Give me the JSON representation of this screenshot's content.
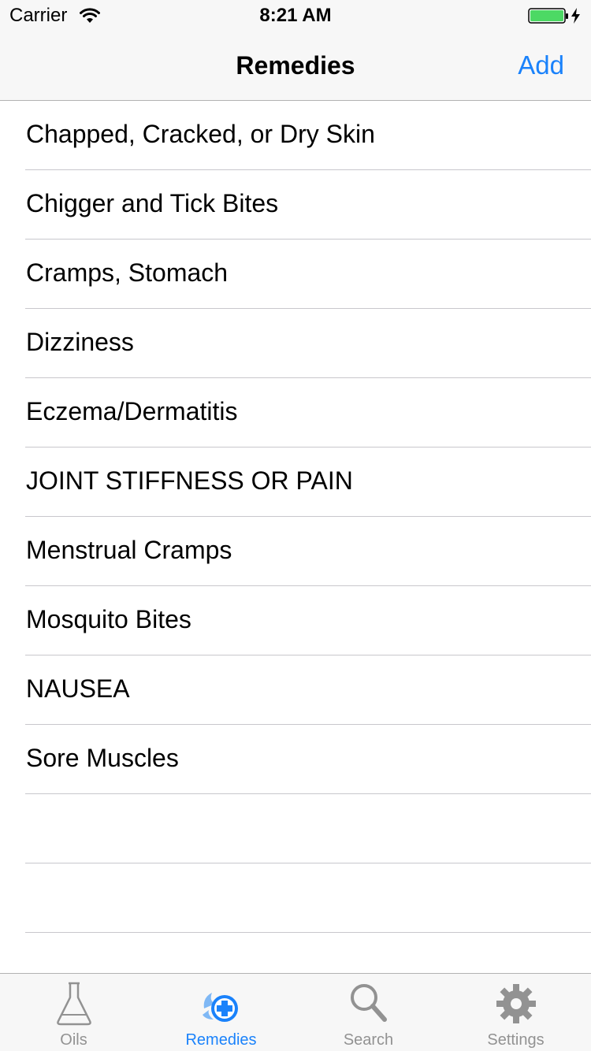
{
  "status_bar": {
    "carrier": "Carrier",
    "time": "8:21 AM",
    "battery_color": "#4cd964"
  },
  "nav": {
    "title": "Remedies",
    "add_label": "Add",
    "accent_color": "#1a82fb"
  },
  "remedies": [
    "Chapped, Cracked, or Dry Skin",
    "Chigger and Tick Bites",
    "Cramps, Stomach",
    "Dizziness",
    "Eczema/Dermatitis",
    "JOINT STIFFNESS OR PAIN",
    "Menstrual Cramps",
    "Mosquito Bites",
    "NAUSEA",
    "Sore Muscles"
  ],
  "tabs": [
    {
      "label": "Oils",
      "icon": "flask-icon",
      "active": false
    },
    {
      "label": "Remedies",
      "icon": "remedy-cross-icon",
      "active": true
    },
    {
      "label": "Search",
      "icon": "magnifier-icon",
      "active": false
    },
    {
      "label": "Settings",
      "icon": "gear-icon",
      "active": false
    }
  ]
}
